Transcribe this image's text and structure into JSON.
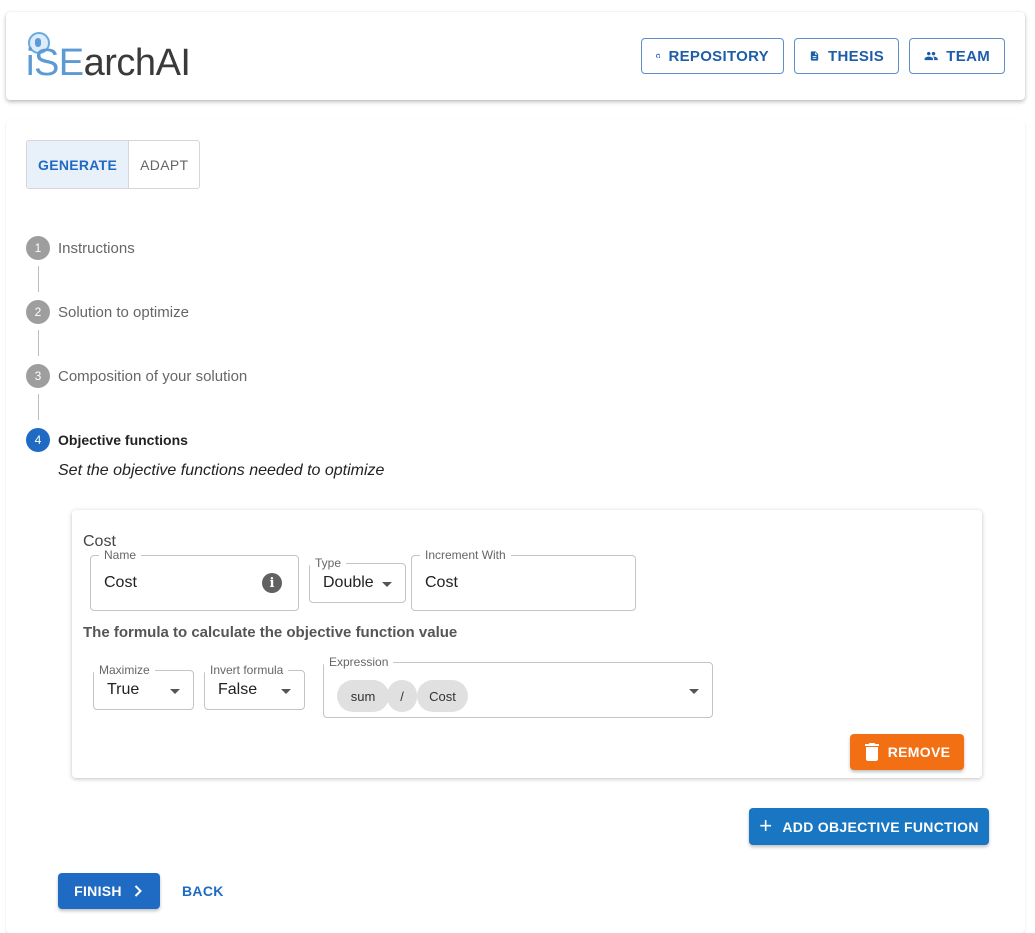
{
  "header": {
    "logo_part1": "iSE",
    "logo_part2": "archAI",
    "buttons": {
      "repository": "REPOSITORY",
      "thesis": "THESIS",
      "team": "TEAM"
    }
  },
  "mode_toggle": {
    "generate": "GENERATE",
    "adapt": "ADAPT",
    "selected": "GENERATE"
  },
  "stepper": {
    "steps": [
      {
        "number": "1",
        "label": "Instructions"
      },
      {
        "number": "2",
        "label": "Solution to optimize"
      },
      {
        "number": "3",
        "label": "Composition of your solution"
      },
      {
        "number": "4",
        "label": "Objective functions"
      }
    ],
    "active_step": 4,
    "active_description": "Set the objective functions needed to optimize"
  },
  "objective": {
    "title": "Cost",
    "name_label": "Name",
    "name_value": "Cost",
    "type_label": "Type",
    "type_value": "Double",
    "increment_label": "Increment With",
    "increment_value": "Cost",
    "formula_heading": "The formula to calculate the objective function value",
    "maximize_label": "Maximize",
    "maximize_value": "True",
    "invert_label": "Invert formula",
    "invert_value": "False",
    "expression_label": "Expression",
    "expression_chips": [
      "sum",
      "/",
      "Cost"
    ],
    "remove_label": "REMOVE"
  },
  "actions": {
    "add_objective": "ADD OBJECTIVE FUNCTION",
    "finish": "FINISH",
    "back": "BACK"
  },
  "colors": {
    "primary": "#1f6bc4",
    "remove": "#f26f14",
    "add_button": "#1976c2"
  }
}
